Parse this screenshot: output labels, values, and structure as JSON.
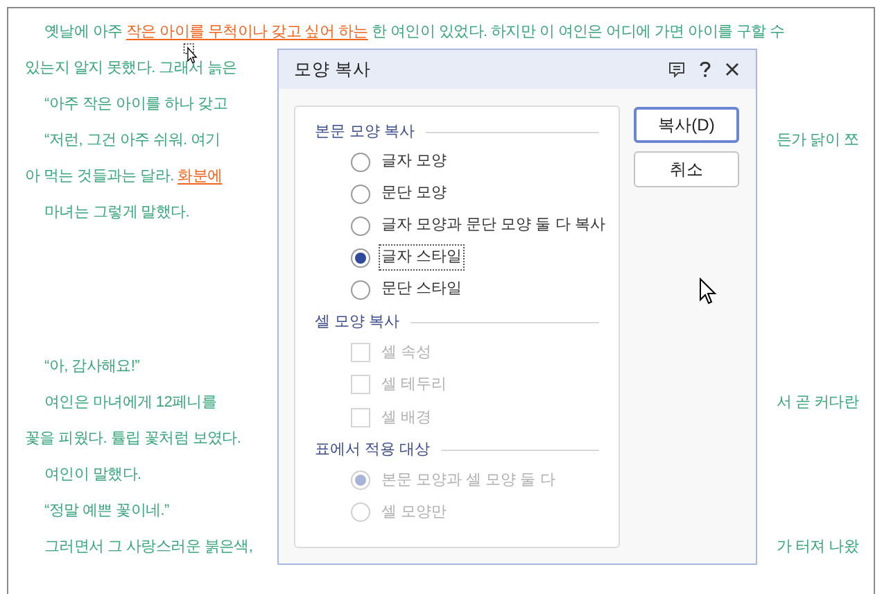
{
  "document": {
    "lines": [
      {
        "kind": "text",
        "indent": true,
        "segments": [
          {
            "kind": "plain",
            "text": "옛날에 아주 "
          },
          {
            "kind": "highlight",
            "text": "작은 아이를 무척이나 갖고 싶어 하는"
          },
          {
            "kind": "plain",
            "text": " 한 여인이 있었다. 하지만 이 여인은 어디에 가면 아이를 구할 수"
          }
        ]
      },
      {
        "kind": "text",
        "indent": false,
        "segments": [
          {
            "kind": "plain",
            "text": "있는지 알지 못했다. 그래서 늙은"
          }
        ]
      },
      {
        "kind": "text",
        "indent": true,
        "segments": [
          {
            "kind": "plain",
            "text": "“아주 작은 아이를 하나 갖고"
          }
        ]
      },
      {
        "kind": "text",
        "indent": true,
        "segments": [
          {
            "kind": "plain",
            "text": "“저런, 그건 아주 쉬워. 여기"
          }
        ],
        "right": "든가 닭이 쪼"
      },
      {
        "kind": "text",
        "indent": false,
        "segments": [
          {
            "kind": "plain",
            "text": "아 먹는 것들과는 달라. "
          },
          {
            "kind": "highlight",
            "text": "화분에"
          }
        ]
      },
      {
        "kind": "text",
        "indent": true,
        "segments": [
          {
            "kind": "plain",
            "text": "마녀는 그렇게 말했다."
          }
        ]
      },
      {
        "kind": "blank"
      },
      {
        "kind": "blank"
      },
      {
        "kind": "text",
        "indent": true,
        "segments": [
          {
            "kind": "plain",
            "text": "“아, 감사해요!”"
          }
        ]
      },
      {
        "kind": "text",
        "indent": true,
        "segments": [
          {
            "kind": "plain",
            "text": "여인은 마녀에게 12페니를"
          }
        ],
        "right": "서 곧 커다란"
      },
      {
        "kind": "text",
        "indent": false,
        "segments": [
          {
            "kind": "plain",
            "text": "꽃을 피웠다. 튤립 꽃처럼 보였다."
          }
        ]
      },
      {
        "kind": "text",
        "indent": true,
        "segments": [
          {
            "kind": "plain",
            "text": "여인이 말했다."
          }
        ]
      },
      {
        "kind": "text",
        "indent": true,
        "segments": [
          {
            "kind": "plain",
            "text": "“정말 예쁜 꽃이네.”"
          }
        ]
      },
      {
        "kind": "text",
        "indent": true,
        "segments": [
          {
            "kind": "plain",
            "text": "그러면서 그 사랑스러운 붉은색,"
          }
        ],
        "right": "가 터져 나왔"
      }
    ]
  },
  "dialog": {
    "title": "모양 복사",
    "sections": [
      {
        "heading": "본문 모양 복사",
        "items": [
          {
            "kind": "radio",
            "label": "글자 모양",
            "selected": false,
            "disabled": false,
            "focused": false
          },
          {
            "kind": "radio",
            "label": "문단 모양",
            "selected": false,
            "disabled": false,
            "focused": false
          },
          {
            "kind": "radio",
            "label": "글자 모양과 문단 모양 둘 다 복사",
            "selected": false,
            "disabled": false,
            "focused": false
          },
          {
            "kind": "radio",
            "label": "글자 스타일",
            "selected": true,
            "disabled": false,
            "focused": true
          },
          {
            "kind": "radio",
            "label": "문단 스타일",
            "selected": false,
            "disabled": false,
            "focused": false
          }
        ]
      },
      {
        "heading": "셀 모양 복사",
        "items": [
          {
            "kind": "checkbox",
            "label": "셀 속성",
            "checked": false,
            "disabled": true
          },
          {
            "kind": "checkbox",
            "label": "셀 테두리",
            "checked": false,
            "disabled": true
          },
          {
            "kind": "checkbox",
            "label": "셀 배경",
            "checked": false,
            "disabled": true
          }
        ]
      },
      {
        "heading": "표에서 적용 대상",
        "items": [
          {
            "kind": "radio",
            "label": "본문 모양과 셀 모양 둘 다",
            "selected": true,
            "disabled": true,
            "focused": false
          },
          {
            "kind": "radio",
            "label": "셀 모양만",
            "selected": false,
            "disabled": true,
            "focused": false
          }
        ]
      }
    ],
    "buttons": [
      {
        "label": "복사(D)",
        "default": true
      },
      {
        "label": "취소",
        "default": false
      }
    ]
  }
}
